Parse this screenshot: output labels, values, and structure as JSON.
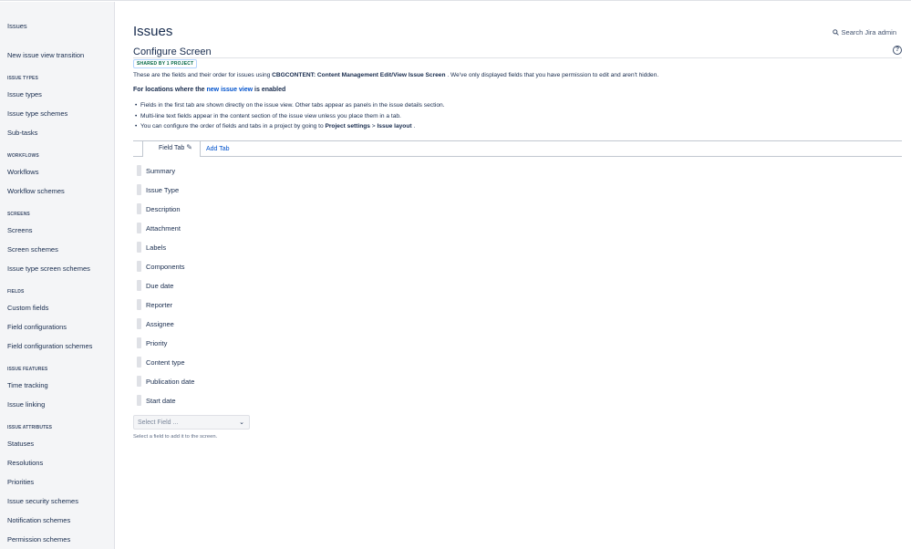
{
  "sidebar": {
    "title": "Issues",
    "top_link": "New issue view transition",
    "sections": [
      {
        "heading": "ISSUE TYPES",
        "items": [
          "Issue types",
          "Issue type schemes",
          "Sub-tasks"
        ]
      },
      {
        "heading": "WORKFLOWS",
        "items": [
          "Workflows",
          "Workflow schemes"
        ]
      },
      {
        "heading": "SCREENS",
        "items": [
          "Screens",
          "Screen schemes",
          "Issue type screen schemes"
        ]
      },
      {
        "heading": "FIELDS",
        "items": [
          "Custom fields",
          "Field configurations",
          "Field configuration schemes"
        ]
      },
      {
        "heading": "ISSUE FEATURES",
        "items": [
          "Time tracking",
          "Issue linking"
        ]
      },
      {
        "heading": "ISSUE ATTRIBUTES",
        "items": [
          "Statuses",
          "Resolutions",
          "Priorities",
          "Issue security schemes",
          "Notification schemes",
          "Permission schemes"
        ]
      }
    ]
  },
  "header": {
    "title": "Issues",
    "search_label": "Search Jira admin"
  },
  "screen": {
    "title": "Configure Screen",
    "shared_badge": "SHARED BY 1 PROJECT",
    "desc_prefix": "These are the fields and their order for issues using ",
    "desc_screen": "CBGCONTENT: Content Management Edit/View Issue Screen",
    "desc_suffix": " . We've only displayed fields that you have permission to edit and aren't hidden.",
    "locations_prefix": "For locations where the ",
    "locations_link": "new issue view",
    "locations_suffix": " is enabled",
    "bullet_1": "Fields in the first tab are shown directly on the issue view. Other tabs appear as panels in the issue details section.",
    "bullet_2": "Multi-line text fields appear in the content section of the issue view unless you place them in a tab.",
    "bullet_3_prefix": "You can configure the order of fields and tabs in a project by going to ",
    "bullet_3_b1": "Project settings",
    "bullet_3_sep": " > ",
    "bullet_3_b2": "Issue layout",
    "bullet_3_suffix": " .",
    "tabs": {
      "active": "Field Tab",
      "add": "Add Tab"
    },
    "fields": [
      "Summary",
      "Issue Type",
      "Description",
      "Attachment",
      "Labels",
      "Components",
      "Due date",
      "Reporter",
      "Assignee",
      "Priority",
      "Content type",
      "Publication date",
      "Start date"
    ],
    "select_placeholder": "Select Field ...",
    "select_hint": "Select a field to add it to the screen."
  },
  "icons": {
    "search": "search-icon",
    "help": "help-icon",
    "edit": "pencil-icon",
    "caret": "chevron-down-icon"
  }
}
